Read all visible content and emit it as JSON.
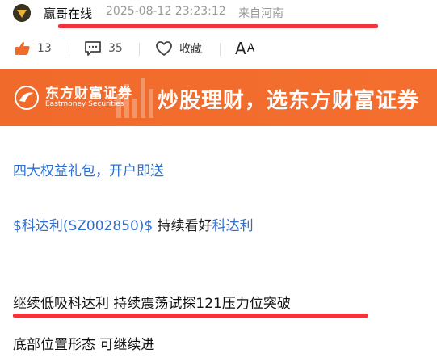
{
  "header": {
    "author": "赢哥在线",
    "timestamp": "2025-08-12 23:23:12",
    "location": "来自河南",
    "avatar_icon": "gold-triangle-avatar"
  },
  "actions": {
    "like_count": "13",
    "comment_count": "35",
    "favorite_label": "收藏",
    "font_big": "A",
    "font_small": "A"
  },
  "banner": {
    "brand_cn": "东方财富证券",
    "brand_en": "Eastmoney Securities",
    "slogan": "炒股理财，选东方财富证券"
  },
  "content": {
    "promo_link": "四大权益礼包，开户即送",
    "stock_tag": "$科达利(SZ002850)$",
    "stock_text": " 持续看好",
    "stock_link": "科达利",
    "main_line": "继续低吸科达利 持续震荡试探121压力位突破",
    "last_line": "底部位置形态  可继续进"
  },
  "colors": {
    "accent_red_line": "#f0343c",
    "link_blue": "#2e6fd0",
    "banner_orange": "#f26d2d",
    "like_orange": "#f06a2c"
  }
}
